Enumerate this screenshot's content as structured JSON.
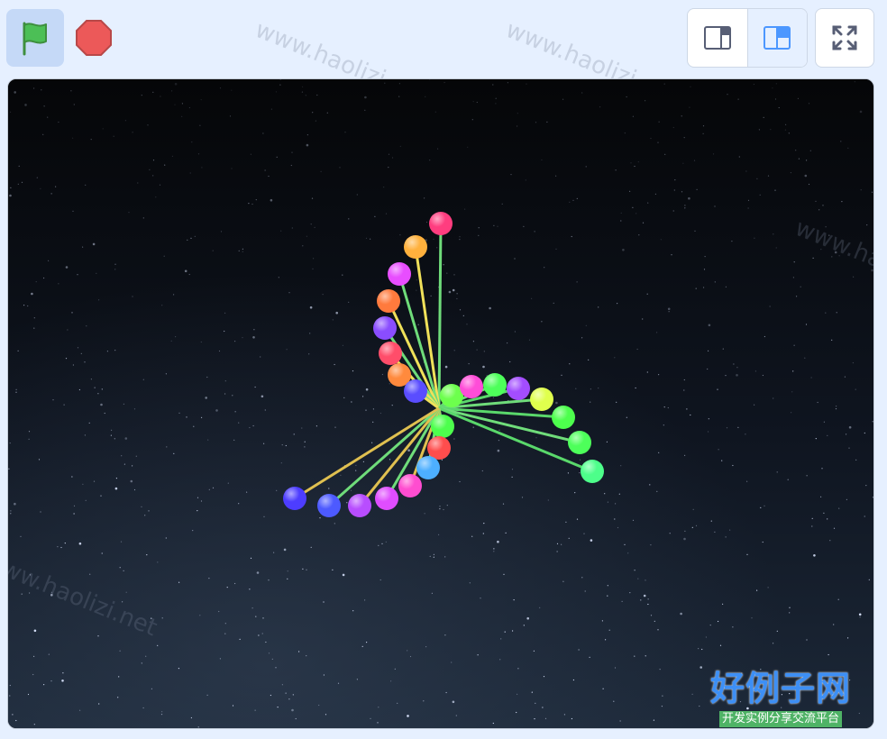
{
  "toolbar": {
    "green_flag": {
      "icon": "green-flag-icon",
      "color": "#4cbf56"
    },
    "stop": {
      "icon": "stop-icon",
      "color": "#ec5959"
    },
    "layout_small": {
      "icon": "small-stage-icon"
    },
    "layout_normal": {
      "icon": "normal-stage-icon",
      "active": true
    },
    "fullscreen": {
      "icon": "fullscreen-icon"
    }
  },
  "watermark": {
    "text": "www.haolizi.net"
  },
  "stage": {
    "background": "starry night sky",
    "sprite_groups": [
      {
        "name": "top-arm",
        "balls": [
          {
            "color": "#ff3d7f"
          },
          {
            "color": "#ffb13d"
          },
          {
            "color": "#e84dff"
          },
          {
            "color": "#ff7a3d"
          },
          {
            "color": "#8a4dff"
          },
          {
            "color": "#ff4d6a"
          },
          {
            "color": "#ff8a3d"
          },
          {
            "color": "#5a4dff"
          }
        ]
      },
      {
        "name": "right-arm",
        "balls": [
          {
            "color": "#6dff4d"
          },
          {
            "color": "#ff4dd8"
          },
          {
            "color": "#4dff5a"
          },
          {
            "color": "#a34dff"
          },
          {
            "color": "#e0ff4d"
          },
          {
            "color": "#4dff4d"
          },
          {
            "color": "#4dff5a"
          },
          {
            "color": "#4dff8a"
          }
        ]
      },
      {
        "name": "bottom-arm",
        "balls": [
          {
            "color": "#4dff4d"
          },
          {
            "color": "#ff4d4d"
          },
          {
            "color": "#4dafff"
          },
          {
            "color": "#ff4dd0"
          },
          {
            "color": "#e04dff"
          },
          {
            "color": "#b84dff"
          },
          {
            "color": "#4d5aff"
          },
          {
            "color": "#4d3dff"
          }
        ]
      }
    ]
  },
  "logo": {
    "main": "好例子网",
    "sub": "开发实例分享交流平台"
  }
}
